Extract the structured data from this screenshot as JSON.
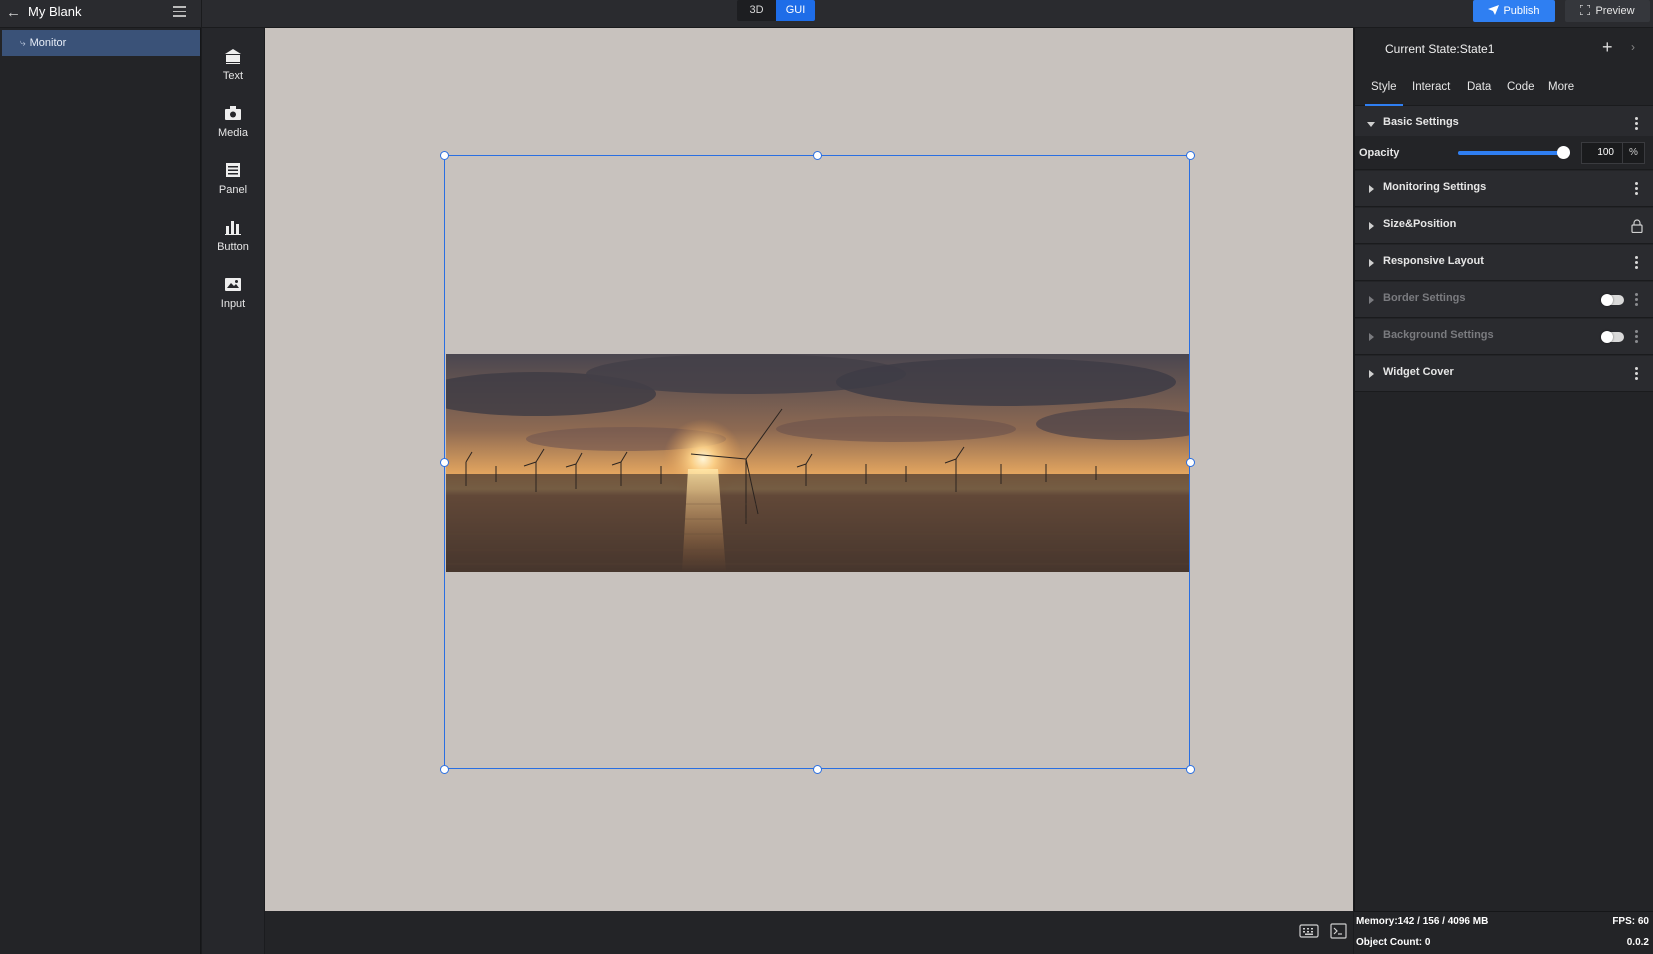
{
  "app": {
    "project_title": "My Blank"
  },
  "mode": {
    "options": [
      "3D",
      "GUI"
    ],
    "selected": "GUI"
  },
  "header": {
    "publish_label": "Publish",
    "preview_label": "Preview"
  },
  "tree": {
    "items": [
      {
        "label": "Monitor",
        "selected": true
      }
    ]
  },
  "tools": [
    {
      "label": "Text",
      "icon": "text-widget-icon"
    },
    {
      "label": "Media",
      "icon": "media-widget-icon"
    },
    {
      "label": "Panel",
      "icon": "panel-widget-icon"
    },
    {
      "label": "Button",
      "icon": "button-widget-icon"
    },
    {
      "label": "Input",
      "icon": "input-widget-icon"
    }
  ],
  "inspector": {
    "state_label": "Current State:State1",
    "tabs": [
      "Style",
      "Interact",
      "Data",
      "Code",
      "More"
    ],
    "active_tab": "Style",
    "basic_settings": {
      "title": "Basic Settings",
      "opacity_label": "Opacity",
      "opacity_value": "100",
      "opacity_unit": "%",
      "opacity_fraction": 1.0
    },
    "sections": [
      {
        "title": "Monitoring Settings",
        "trailing": "menu",
        "enabled": true
      },
      {
        "title": "Size&Position",
        "trailing": "lock",
        "enabled": true
      },
      {
        "title": "Responsive Layout",
        "trailing": "menu",
        "enabled": true
      },
      {
        "title": "Border Settings",
        "trailing": "toggle",
        "enabled": false
      },
      {
        "title": "Background Settings",
        "trailing": "toggle",
        "enabled": false
      },
      {
        "title": "Widget Cover",
        "trailing": "menu",
        "enabled": true
      }
    ]
  },
  "status": {
    "memory": "Memory:142 / 156 / 4096 MB",
    "object_count": "Object Count: 0",
    "fps": "FPS: 60",
    "version": "0.0.2"
  },
  "colors": {
    "accent": "#2f7ff2",
    "canvas_bg": "#c8c2be",
    "selection": "#2a6fe2",
    "panel_bg": "#232427"
  }
}
